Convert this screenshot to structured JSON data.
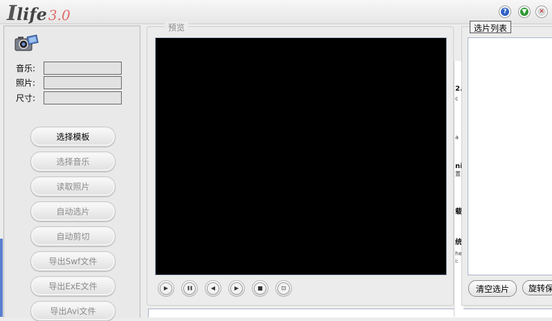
{
  "titlebar": {
    "logo_i": "I",
    "logo_life": "life",
    "logo_version": "3.0",
    "help_glyph": "?",
    "minimize_glyph": "▼",
    "close_glyph": "✕"
  },
  "left_panel": {
    "info": [
      {
        "label": "音乐:"
      },
      {
        "label": "照片:"
      },
      {
        "label": "尺寸:"
      }
    ],
    "buttons": [
      {
        "label": "选择模板",
        "enabled": true
      },
      {
        "label": "选择音乐",
        "enabled": false
      },
      {
        "label": "读取照片",
        "enabled": false
      },
      {
        "label": "自动选片",
        "enabled": false
      },
      {
        "label": "自动剪切",
        "enabled": false
      },
      {
        "label": "导出Swf文件",
        "enabled": false
      },
      {
        "label": "导出ExE文件",
        "enabled": false
      },
      {
        "label": "导出Avi文件",
        "enabled": false
      }
    ]
  },
  "preview": {
    "legend": "预览",
    "controls": [
      {
        "name": "play",
        "glyph": "▶"
      },
      {
        "name": "pause",
        "glyph": "❚❚"
      },
      {
        "name": "previous",
        "glyph": "◀"
      },
      {
        "name": "next",
        "glyph": "▶"
      },
      {
        "name": "stop",
        "glyph": "■"
      },
      {
        "name": "zoom",
        "glyph": "⊡"
      }
    ]
  },
  "background_window": {
    "fragments": [
      "2.",
      "c",
      "a",
      "ni",
      "置",
      "载",
      "统",
      "he",
      "i:"
    ]
  },
  "selection": {
    "legend": "选片列表",
    "clear_label": "清空选片",
    "rotate_label": "旋转保"
  },
  "colors": {
    "accent_blue": "#2f62c4",
    "minimize_green": "#2f9a35",
    "logo_version_red": "#e06a6a",
    "left_edge": "#5a7fd0"
  }
}
